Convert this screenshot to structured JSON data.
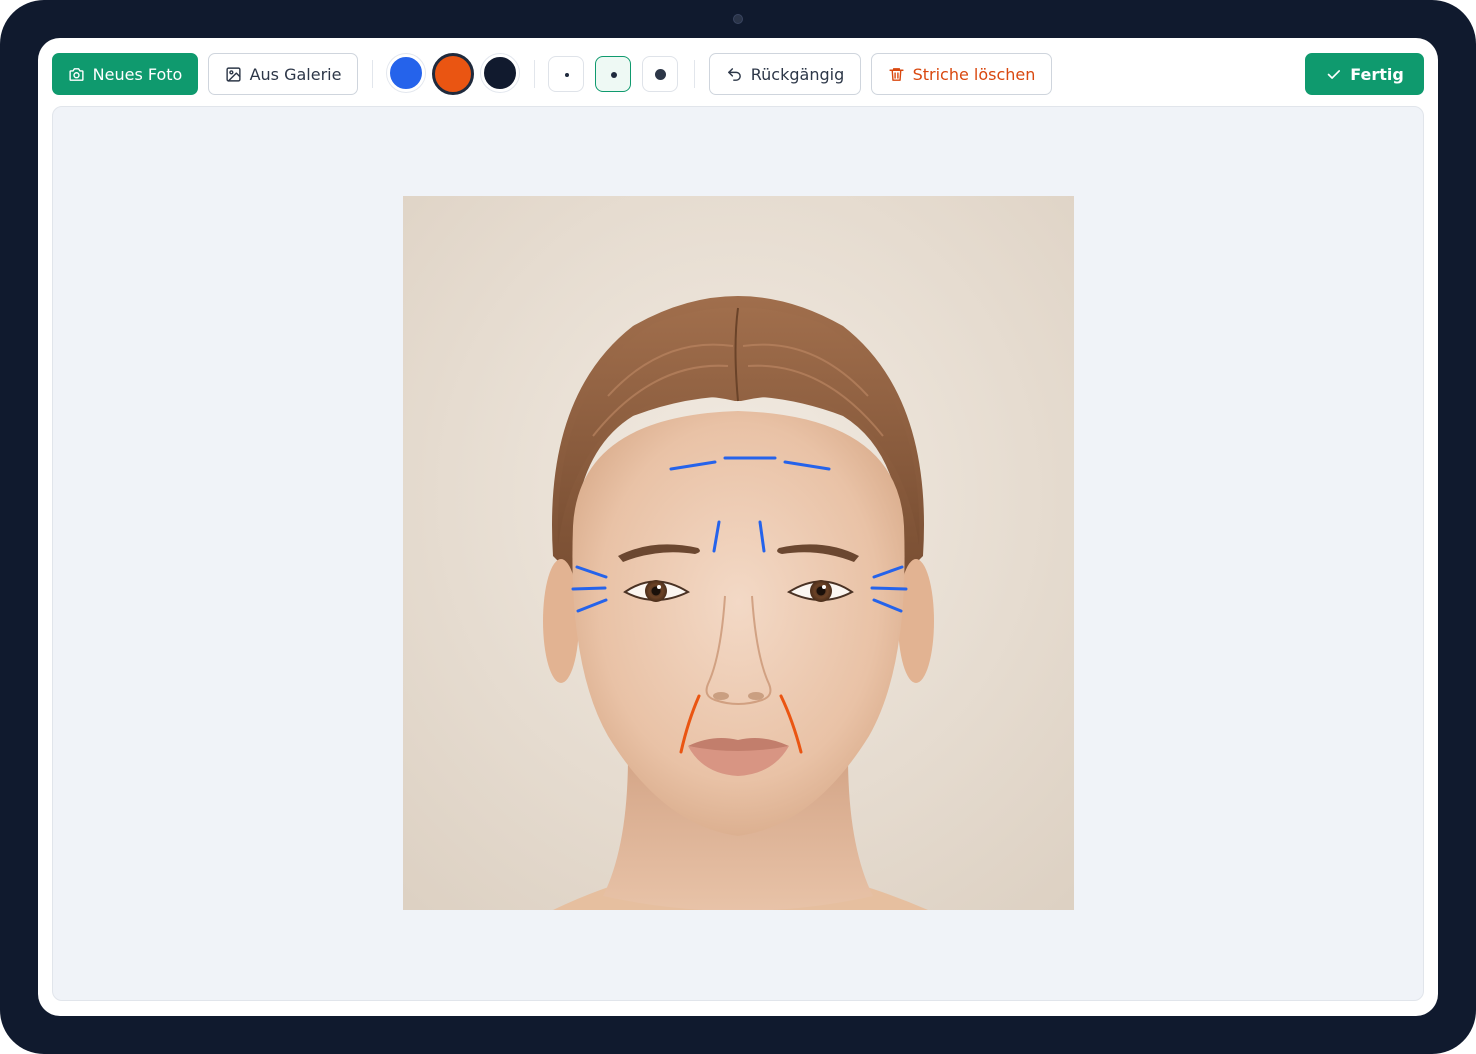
{
  "toolbar": {
    "new_photo_label": "Neues Foto",
    "gallery_label": "Aus Galerie",
    "undo_label": "Rückgängig",
    "clear_label": "Striche löschen",
    "done_label": "Fertig"
  },
  "colors": {
    "brand": "#0f9a6e",
    "swatch_blue": "#2563eb",
    "swatch_orange": "#ea5512",
    "swatch_dark": "#111a2e",
    "danger": "#d9480f",
    "canvas_bg": "#f0f3f8"
  },
  "palette": {
    "selected": "orange"
  },
  "brush_sizes": {
    "selected": "medium"
  },
  "icons": {
    "new_photo": "camera-icon",
    "gallery": "image-icon",
    "undo": "undo-icon",
    "clear": "trash-icon",
    "done": "check-icon"
  }
}
